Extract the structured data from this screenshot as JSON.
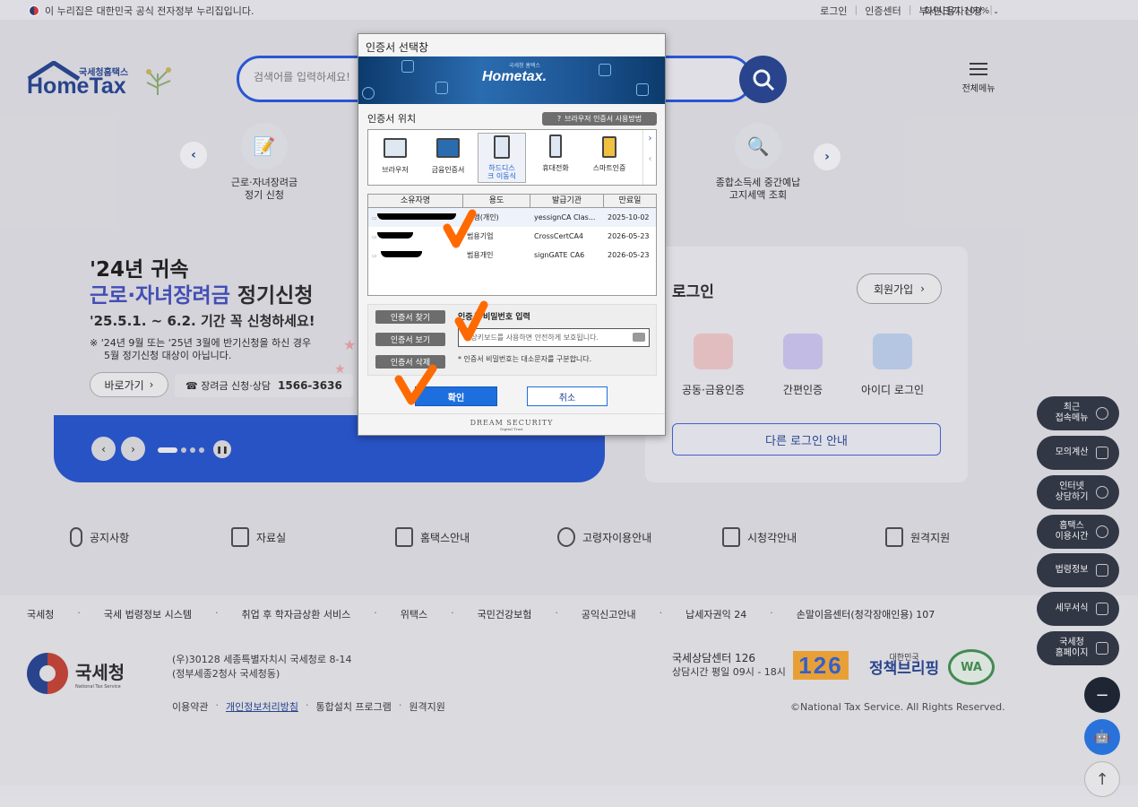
{
  "topbar": {
    "gov_notice": "이 누리집은 대한민국 공식 전자정부 누리집입니다.",
    "links": [
      "로그인",
      "인증센터",
      "부서사용자신청"
    ],
    "zoom_label": "화면크기",
    "zoom_value": "100%"
  },
  "header": {
    "logo_small": "국세청홈택스",
    "logo_big": "HomeTax",
    "search_placeholder": "검색어를 입력하세요!",
    "menu_label": "전체메뉴"
  },
  "quick_menu": [
    {
      "label1": "근로·자녀장려금",
      "label2": "정기 신청"
    },
    {
      "label1": "종합소득세 중간예납",
      "label2": "고지세액 조회"
    }
  ],
  "hero": {
    "line1": "'24년 귀속",
    "line2_blue": "근로·자녀장려금",
    "line2_rest": " 정기신청",
    "line3": "'25.5.1. ~ 6.2. 기간 꼭 신청하세요!",
    "note1": "※ '24년 9월 또는 '25년 3월에 반기신청을 하신 경우",
    "note2": "5월 정기신청 대상이 아닙니다.",
    "go_button": "바로가기",
    "phone_label": "☎ 장려금 신청·상담",
    "phone_number": "1566-3636"
  },
  "login": {
    "title": "로그인",
    "join_button": "회원가입",
    "options": [
      "공동·금융인증",
      "간편인증",
      "아이디 로그인"
    ],
    "other_login": "다른 로그인 안내"
  },
  "shortcuts": [
    "공지사항",
    "자료실",
    "홈택스안내",
    "고령자이용안내",
    "시청각안내",
    "원격지원"
  ],
  "footer": {
    "links": [
      "국세청",
      "국세 법령정보 시스템",
      "취업 후 학자금상환 서비스",
      "위택스",
      "국민건강보험",
      "공익신고안내",
      "납세자권익 24",
      "손말이음센터(청각장애인용) 107"
    ],
    "org_name": "국세청",
    "org_en": "National Tax Service",
    "address1": "(우)30128 세종특별자치시 국세청로 8-14",
    "address2": "(정부세종2청사 국세청동)",
    "bottom_links": [
      "이용약관",
      "개인정보처리방침",
      "통합설치 프로그램",
      "원격지원"
    ],
    "center": "국세상담센터 126",
    "hours": "상담시간 평일 09시 - 18시",
    "badge_126": "126",
    "policy_small": "대한민국",
    "policy_big": "정책브리핑",
    "seal": "WA",
    "copyright": "©National Tax Service. All Rights Reserved."
  },
  "floating": [
    {
      "l1": "최근",
      "l2": "접속메뉴"
    },
    {
      "l1": "모의계산",
      "l2": ""
    },
    {
      "l1": "인터넷",
      "l2": "상담하기"
    },
    {
      "l1": "홈택스",
      "l2": "이용시간"
    },
    {
      "l1": "법령정보",
      "l2": ""
    },
    {
      "l1": "세무서식",
      "l2": ""
    },
    {
      "l1": "국세청",
      "l2": "홈페이지"
    }
  ],
  "dialog": {
    "title": "인증서 선택창",
    "banner_brand": "Hometax.",
    "banner_sub": "국세청 홈택스",
    "location_label": "인증서 위치",
    "help_button": "브라우저 인증서 사용방법",
    "locations": [
      "브라우저",
      "금융인증서",
      "하드디스크 이동식",
      "휴대전화",
      "스마트인증"
    ],
    "columns": [
      "소유자명",
      "용도",
      "발급기관",
      "만료일"
    ],
    "rows": [
      {
        "usage": "은행(개인)",
        "issuer": "yessignCA Clas...",
        "expiry": "2025-10-02"
      },
      {
        "usage": "범용기업",
        "issuer": "CrossCertCA4",
        "expiry": "2026-05-23"
      },
      {
        "usage": "범용개인",
        "issuer": "signGATE CA6",
        "expiry": "2026-05-23"
      }
    ],
    "btn_find": "인증서 찾기",
    "btn_view": "인증서 보기",
    "btn_delete": "인증서 삭제",
    "pw_label": "인증서 비밀번호 입력",
    "pw_placeholder": "가상키보드를 사용하면 안전하게 보호됩니다.",
    "pw_note": "* 인증서 비밀번호는 대소문자를 구분합니다.",
    "ok": "확인",
    "cancel": "취소",
    "footer_brand": "DREAM SECURITY",
    "footer_sub": "Digital Trust"
  },
  "annotation_color": "#ff6a00"
}
